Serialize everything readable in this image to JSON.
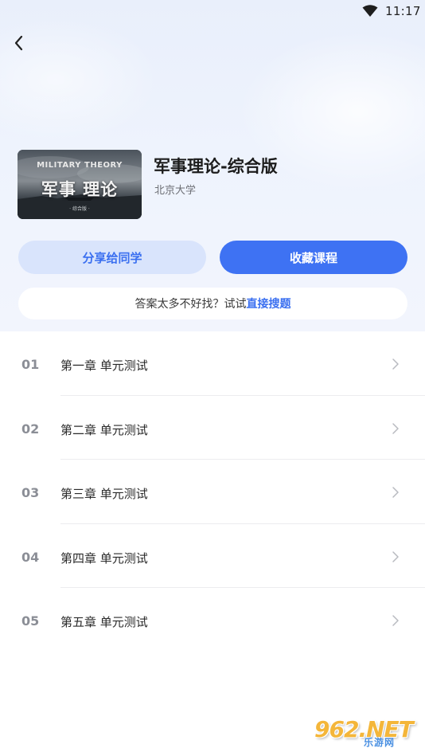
{
  "status_bar": {
    "time": "11:17",
    "wifi_icon": "wifi-icon"
  },
  "nav": {
    "back_icon": "chevron-left-icon"
  },
  "course": {
    "cover_line1": "MILITARY THEORY",
    "cover_line2": "军事 理论",
    "cover_line3": "· 综合版 ·",
    "title": "军事理论-综合版",
    "school": "北京大学"
  },
  "actions": {
    "share_label": "分享给同学",
    "favorite_label": "收藏课程"
  },
  "tip": {
    "text": "答案太多不好找？试试",
    "link": "直接搜题"
  },
  "chapters": [
    {
      "num": "01",
      "name": "第一章 单元测试"
    },
    {
      "num": "02",
      "name": "第二章 单元测试"
    },
    {
      "num": "03",
      "name": "第三章 单元测试"
    },
    {
      "num": "04",
      "name": "第四章 单元测试"
    },
    {
      "num": "05",
      "name": "第五章 单元测试"
    }
  ],
  "watermark": {
    "brand": "962.NET",
    "site": "乐游网"
  },
  "colors": {
    "accent": "#3e72f3",
    "accent_light": "#d9e4fc",
    "text": "#2a2a2a",
    "muted": "#8b8e96"
  }
}
